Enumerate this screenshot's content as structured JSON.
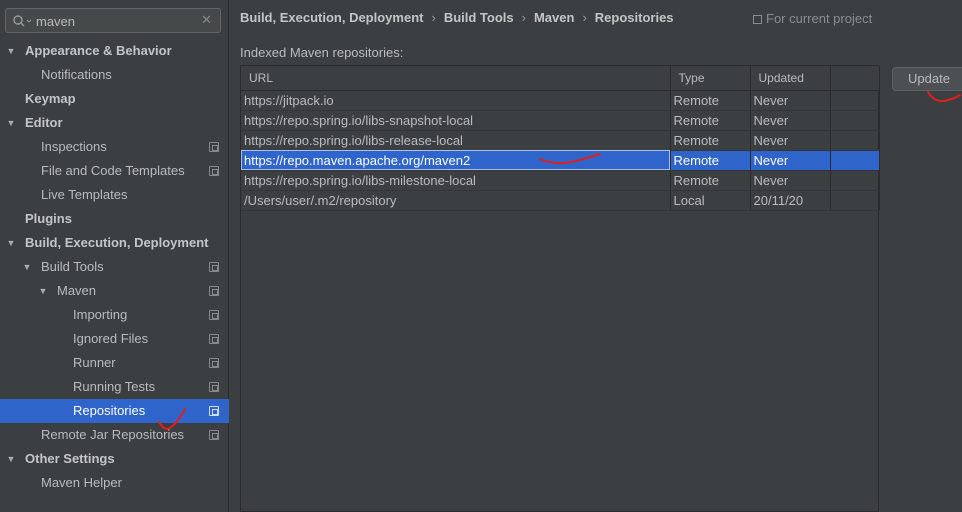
{
  "search": {
    "value": "maven",
    "icon": "search-icon"
  },
  "tree": [
    {
      "label": "Appearance & Behavior",
      "bold": true,
      "arrow": "▼",
      "level": 0
    },
    {
      "label": "Notifications",
      "bold": false,
      "arrow": "",
      "level": 1
    },
    {
      "label": "Keymap",
      "bold": true,
      "arrow": "",
      "level": 0
    },
    {
      "label": "Editor",
      "bold": true,
      "arrow": "▼",
      "level": 0
    },
    {
      "label": "Inspections",
      "bold": false,
      "arrow": "",
      "level": 1,
      "project": true
    },
    {
      "label": "File and Code Templates",
      "bold": false,
      "arrow": "",
      "level": 1,
      "project": true
    },
    {
      "label": "Live Templates",
      "bold": false,
      "arrow": "",
      "level": 1
    },
    {
      "label": "Plugins",
      "bold": true,
      "arrow": "",
      "level": 0
    },
    {
      "label": "Build, Execution, Deployment",
      "bold": true,
      "arrow": "▼",
      "level": 0
    },
    {
      "label": "Build Tools",
      "bold": false,
      "arrow": "▼",
      "level": 1,
      "project": true
    },
    {
      "label": "Maven",
      "bold": false,
      "arrow": "▼",
      "level": 2,
      "project": true
    },
    {
      "label": "Importing",
      "bold": false,
      "arrow": "",
      "level": 3,
      "project": true
    },
    {
      "label": "Ignored Files",
      "bold": false,
      "arrow": "",
      "level": 3,
      "project": true
    },
    {
      "label": "Runner",
      "bold": false,
      "arrow": "",
      "level": 3,
      "project": true
    },
    {
      "label": "Running Tests",
      "bold": false,
      "arrow": "",
      "level": 3,
      "project": true
    },
    {
      "label": "Repositories",
      "bold": false,
      "arrow": "",
      "level": 3,
      "project": true,
      "selected": true
    },
    {
      "label": "Remote Jar Repositories",
      "bold": false,
      "arrow": "",
      "level": 1,
      "project": true
    },
    {
      "label": "Other Settings",
      "bold": true,
      "arrow": "▼",
      "level": 0
    },
    {
      "label": "Maven Helper",
      "bold": false,
      "arrow": "",
      "level": 1
    }
  ],
  "breadcrumb": [
    "Build, Execution, Deployment",
    "Build Tools",
    "Maven",
    "Repositories"
  ],
  "breadcrumb_separator": "›",
  "scope_label": "For current project",
  "section_label": "Indexed Maven repositories:",
  "table": {
    "columns": [
      "URL",
      "Type",
      "Updated"
    ],
    "rows": [
      {
        "url": "https://jitpack.io",
        "type": "Remote",
        "updated": "Never"
      },
      {
        "url": "https://repo.spring.io/libs-snapshot-local",
        "type": "Remote",
        "updated": "Never"
      },
      {
        "url": "https://repo.spring.io/libs-release-local",
        "type": "Remote",
        "updated": "Never"
      },
      {
        "url": "https://repo.maven.apache.org/maven2",
        "type": "Remote",
        "updated": "Never",
        "selected": true
      },
      {
        "url": "https://repo.spring.io/libs-milestone-local",
        "type": "Remote",
        "updated": "Never"
      },
      {
        "url": "/Users/user/.m2/repository",
        "type": "Local",
        "updated": "20/11/20"
      }
    ]
  },
  "update_button": "Update",
  "colors": {
    "selection": "#2f65ca",
    "annotation": "#e02020",
    "background": "#3c3f41"
  }
}
